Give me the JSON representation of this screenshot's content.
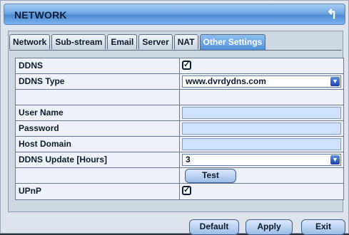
{
  "window": {
    "title": "NETWORK",
    "back_icon": "back-arrow-icon"
  },
  "tabs": [
    {
      "label": "Network",
      "active": false
    },
    {
      "label": "Sub-stream",
      "active": false
    },
    {
      "label": "Email",
      "active": false
    },
    {
      "label": "Server",
      "active": false
    },
    {
      "label": "NAT",
      "active": false
    },
    {
      "label": "Other Settings",
      "active": true
    }
  ],
  "fields": {
    "ddns": {
      "label": "DDNS",
      "checked": true
    },
    "ddns_type": {
      "label": "DDNS Type",
      "value": "www.dvrdydns.com"
    },
    "user_name": {
      "label": "User Name",
      "value": ""
    },
    "password": {
      "label": "Password",
      "value": ""
    },
    "host_domain": {
      "label": "Host Domain",
      "value": ""
    },
    "ddns_update": {
      "label": "DDNS Update [Hours]",
      "value": "3"
    },
    "test_button": "Test",
    "upnp": {
      "label": "UPnP",
      "checked": true
    }
  },
  "buttons": {
    "default": "Default",
    "apply": "Apply",
    "exit": "Exit"
  },
  "icons": {
    "checkmark": "✓",
    "dropdown": "▼"
  },
  "colors": {
    "accent": "#4f8bd2",
    "input_bg": "#cfe2fb"
  }
}
